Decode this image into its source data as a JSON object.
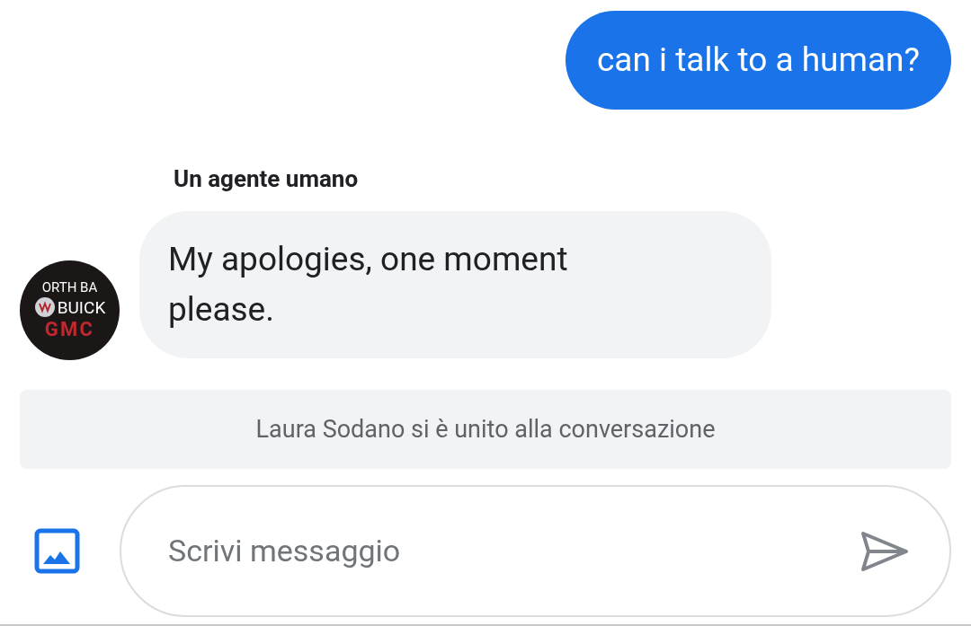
{
  "messages": [
    {
      "kind": "outgoing",
      "text": "can i talk to a human?"
    },
    {
      "kind": "incoming",
      "sender": "Un agente umano",
      "text": "My apologies, one moment please.",
      "avatar": [
        "ORTH BA",
        "BUICK",
        "GMC"
      ]
    },
    {
      "kind": "system",
      "text": "Laura Sodano si è unito alla conversazione"
    }
  ],
  "composer": {
    "placeholder": "Scrivi messaggio"
  }
}
